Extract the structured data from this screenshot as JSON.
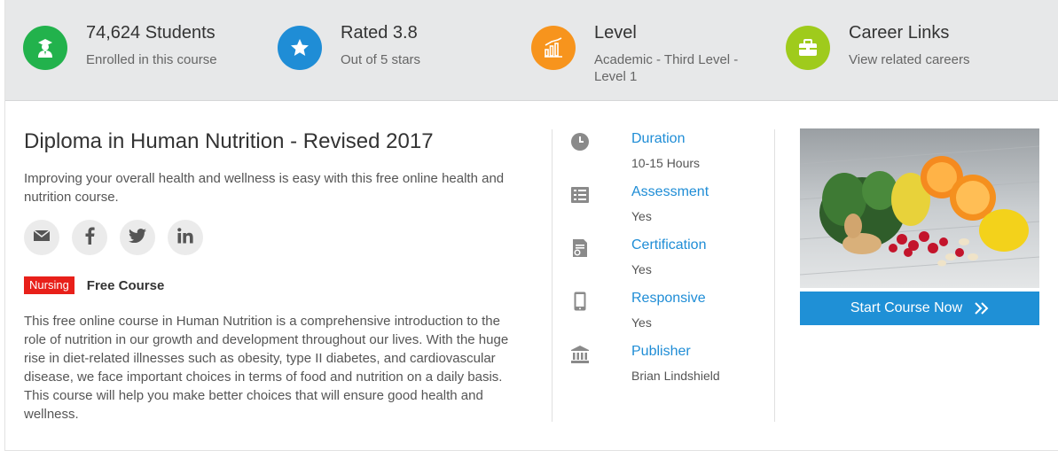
{
  "stats": [
    {
      "title": "74,624 Students",
      "subtitle": "Enrolled in this course",
      "icon": "graduate-icon",
      "color": "#22b24c"
    },
    {
      "title": "Rated 3.8",
      "subtitle": "Out of 5 stars",
      "icon": "star-icon",
      "color": "#1f8dd6"
    },
    {
      "title": "Level",
      "subtitle": "Academic - Third Level - Level 1",
      "icon": "chart-icon",
      "color": "#f7941d"
    },
    {
      "title": "Career Links",
      "subtitle": "View related careers",
      "icon": "briefcase-icon",
      "color": "#9fcb1c"
    }
  ],
  "course": {
    "title": "Diploma in Human Nutrition - Revised 2017",
    "summary": "Improving your overall health and wellness is easy with this free online health and nutrition course.",
    "tag": "Nursing",
    "price": "Free Course",
    "description": "This free online course in Human Nutrition is a comprehensive introduction to the role of nutrition in our growth and development throughout our lives. With the huge rise in diet-related illnesses such as obesity, type II diabetes, and cardiovascular disease, we face important choices in terms of food and nutrition on a daily basis. This course will help you make better choices that will ensure good health and wellness."
  },
  "share": [
    "email-icon",
    "facebook-icon",
    "twitter-icon",
    "linkedin-icon"
  ],
  "info": [
    {
      "label": "Duration",
      "value": "10-15 Hours",
      "icon": "clock-icon"
    },
    {
      "label": "Assessment",
      "value": "Yes",
      "icon": "checklist-icon"
    },
    {
      "label": "Certification",
      "value": "Yes",
      "icon": "certificate-icon"
    },
    {
      "label": "Responsive",
      "value": "Yes",
      "icon": "mobile-icon"
    },
    {
      "label": "Publisher",
      "value": "Brian Lindshield",
      "icon": "institution-icon"
    }
  ],
  "cta": {
    "label": "Start Course Now",
    "color": "#1f90d6"
  },
  "colors": {
    "link": "#1f8dd6",
    "tag": "#e8201a",
    "bar": "#e7e8e9"
  }
}
